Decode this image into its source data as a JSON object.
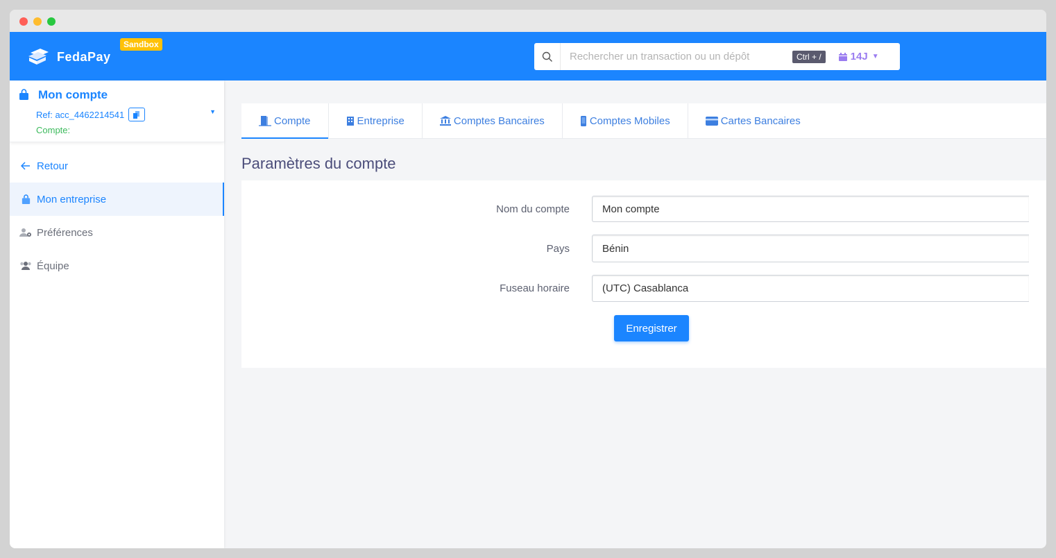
{
  "brand": {
    "name": "FedaPay",
    "env_badge": "Sandbox"
  },
  "search": {
    "placeholder": "Rechercher un transaction ou un dépôt",
    "shortcut": "Ctrl + /"
  },
  "period": {
    "label": "14J"
  },
  "account": {
    "name": "Mon compte",
    "ref": "Ref: acc_4462214541",
    "type_label": "Compte:"
  },
  "sidebar": {
    "items": [
      {
        "label": "Retour"
      },
      {
        "label": "Mon entreprise"
      },
      {
        "label": "Préférences"
      },
      {
        "label": "Équipe"
      }
    ]
  },
  "tabs": [
    {
      "label": "Compte"
    },
    {
      "label": "Entreprise"
    },
    {
      "label": "Comptes Bancaires"
    },
    {
      "label": "Comptes Mobiles"
    },
    {
      "label": "Cartes Bancaires"
    }
  ],
  "page": {
    "title": "Paramètres du compte"
  },
  "form": {
    "account_name": {
      "label": "Nom du compte",
      "value": "Mon compte"
    },
    "country": {
      "label": "Pays",
      "value": "Bénin"
    },
    "timezone": {
      "label": "Fuseau horaire",
      "value": "(UTC) Casablanca"
    },
    "save_label": "Enregistrer"
  },
  "colors": {
    "primary": "#1b85ff",
    "badge": "#ffc107",
    "success": "#3cba5c",
    "period": "#9a7cf0"
  }
}
